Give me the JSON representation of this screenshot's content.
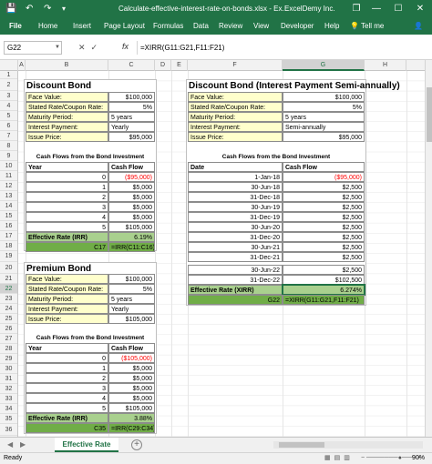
{
  "window": {
    "title": "Calculate-effective-interest-rate-on-bonds.xlsx - Ex...",
    "user": "ExcelDemy Inc.",
    "restore_glyph": "❐",
    "minimize_glyph": "—",
    "maximize_glyph": "☐",
    "close_glyph": "✕"
  },
  "quick_access": {
    "save_glyph": "💾",
    "undo_glyph": "↶",
    "redo_glyph": "↷",
    "extra_glyph": "▾"
  },
  "ribbon": {
    "tabs": [
      "File",
      "Home",
      "Insert",
      "Page Layout",
      "Formulas",
      "Data",
      "Review",
      "View",
      "Developer",
      "Help"
    ],
    "tell_me": "Tell me",
    "tell_me_glyph": "💡",
    "share_glyph": "👤"
  },
  "formula_bar": {
    "name_box": "G22",
    "formula": "=XIRR(G11:G21,F11:F21)",
    "cancel_glyph": "✕",
    "enter_glyph": "✓",
    "fx": "fx"
  },
  "columns": [
    "A",
    "B",
    "C",
    "D",
    "E",
    "F",
    "G",
    "H"
  ],
  "rows": [
    "1",
    "2",
    "3",
    "4",
    "5",
    "6",
    "7",
    "8",
    "9",
    "10",
    "11",
    "12",
    "13",
    "14",
    "15",
    "16",
    "17",
    "18",
    "19",
    "20",
    "21",
    "22",
    "23",
    "24",
    "25",
    "26",
    "27",
    "28",
    "29",
    "30",
    "31",
    "32",
    "33",
    "34",
    "35",
    "36"
  ],
  "discount_bond": {
    "title": "Discount Bond",
    "params": [
      {
        "label": "Face Value:",
        "value": "$100,000"
      },
      {
        "label": "Stated Rate/Coupon Rate:",
        "value": "5%"
      },
      {
        "label": "Maturity Period:",
        "value": "5 years"
      },
      {
        "label": "Interest Payment:",
        "value": "Yearly"
      },
      {
        "label": "Issue Price:",
        "value": "$95,000"
      }
    ],
    "cf_title": "Cash Flows from the Bond Investment",
    "cf_headers": [
      "Year",
      "Cash Flow"
    ],
    "cf_rows": [
      {
        "year": "0",
        "cf": "($95,000)"
      },
      {
        "year": "1",
        "cf": "$5,000"
      },
      {
        "year": "2",
        "cf": "$5,000"
      },
      {
        "year": "3",
        "cf": "$5,000"
      },
      {
        "year": "4",
        "cf": "$5,000"
      },
      {
        "year": "5",
        "cf": "$105,000"
      }
    ],
    "eff_label": "Effective Rate (IRR)",
    "eff_value": "6.19%",
    "formula_ref": "C17",
    "formula_text": "=IRR(C11:C16)"
  },
  "premium_bond": {
    "title": "Premium Bond",
    "params": [
      {
        "label": "Face Value:",
        "value": "$100,000"
      },
      {
        "label": "Stated Rate/Coupon Rate:",
        "value": "5%"
      },
      {
        "label": "Maturity Period:",
        "value": "5 years"
      },
      {
        "label": "Interest Payment:",
        "value": "Yearly"
      },
      {
        "label": "Issue Price:",
        "value": "$105,000"
      }
    ],
    "cf_title": "Cash Flows from the Bond Investment",
    "cf_headers": [
      "Year",
      "Cash Flow"
    ],
    "cf_rows": [
      {
        "year": "0",
        "cf": "($105,000)"
      },
      {
        "year": "1",
        "cf": "$5,000"
      },
      {
        "year": "2",
        "cf": "$5,000"
      },
      {
        "year": "3",
        "cf": "$5,000"
      },
      {
        "year": "4",
        "cf": "$5,000"
      },
      {
        "year": "5",
        "cf": "$105,000"
      }
    ],
    "eff_label": "Effective Rate (IRR)",
    "eff_value": "3.88%",
    "formula_ref": "C35",
    "formula_text": "=IRR(C29:C34)"
  },
  "semi_bond": {
    "title": "Discount Bond (Interest Payment Semi-annually)",
    "params": [
      {
        "label": "Face Value:",
        "value": "$100,000"
      },
      {
        "label": "Stated Rate/Coupon Rate:",
        "value": "5%"
      },
      {
        "label": "Maturity Period:",
        "value": "5 years"
      },
      {
        "label": "Interest Payment:",
        "value": "Semi-annually"
      },
      {
        "label": "Issue Price:",
        "value": "$95,000"
      }
    ],
    "cf_title": "Cash Flows from the Bond Investment",
    "cf_headers": [
      "Date",
      "Cash Flow"
    ],
    "cf_rows": [
      {
        "date": "1-Jan-18",
        "cf": "($95,000)"
      },
      {
        "date": "30-Jun-18",
        "cf": "$2,500"
      },
      {
        "date": "31-Dec-18",
        "cf": "$2,500"
      },
      {
        "date": "30-Jun-19",
        "cf": "$2,500"
      },
      {
        "date": "31-Dec-19",
        "cf": "$2,500"
      },
      {
        "date": "30-Jun-20",
        "cf": "$2,500"
      },
      {
        "date": "31-Dec-20",
        "cf": "$2,500"
      },
      {
        "date": "30-Jun-21",
        "cf": "$2,500"
      },
      {
        "date": "31-Dec-21",
        "cf": "$2,500"
      },
      {
        "date": "30-Jun-22",
        "cf": "$2,500"
      },
      {
        "date": "31-Dec-22",
        "cf": "$102,500"
      }
    ],
    "eff_label": "Effective Rate (XIRR)",
    "eff_value": "6.274%",
    "formula_ref": "G22",
    "formula_text": "=XIRR(G11:G21,F11:F21)"
  },
  "sheet_tab": "Effective Rate",
  "add_sheet_glyph": "+",
  "status": {
    "ready": "Ready",
    "zoom": "90%",
    "zoom_minus": "−",
    "zoom_plus": "+"
  }
}
